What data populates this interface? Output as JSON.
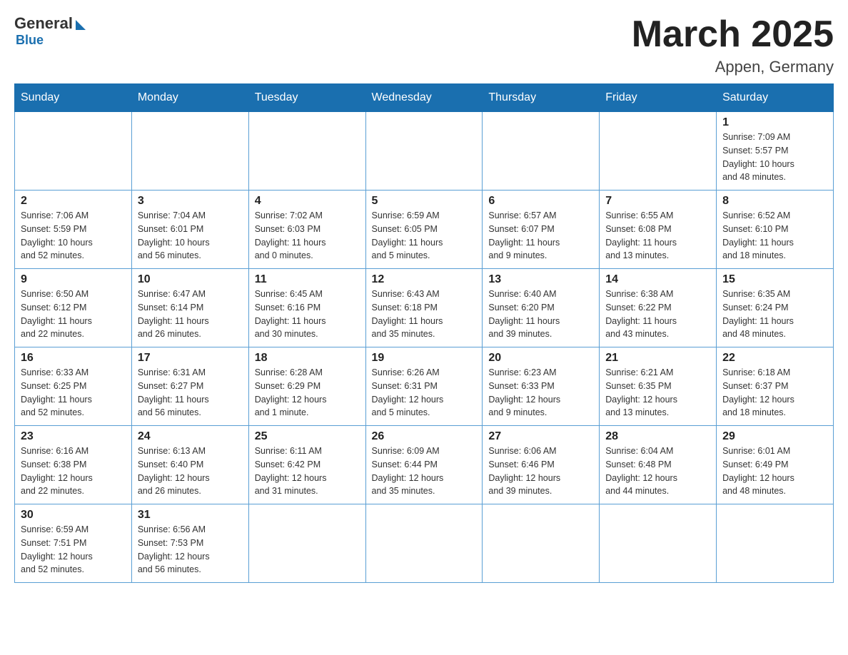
{
  "header": {
    "logo_general": "General",
    "logo_blue": "Blue",
    "month_title": "March 2025",
    "location": "Appen, Germany"
  },
  "weekdays": [
    "Sunday",
    "Monday",
    "Tuesday",
    "Wednesday",
    "Thursday",
    "Friday",
    "Saturday"
  ],
  "weeks": [
    [
      {
        "day": "",
        "info": ""
      },
      {
        "day": "",
        "info": ""
      },
      {
        "day": "",
        "info": ""
      },
      {
        "day": "",
        "info": ""
      },
      {
        "day": "",
        "info": ""
      },
      {
        "day": "",
        "info": ""
      },
      {
        "day": "1",
        "info": "Sunrise: 7:09 AM\nSunset: 5:57 PM\nDaylight: 10 hours\nand 48 minutes."
      }
    ],
    [
      {
        "day": "2",
        "info": "Sunrise: 7:06 AM\nSunset: 5:59 PM\nDaylight: 10 hours\nand 52 minutes."
      },
      {
        "day": "3",
        "info": "Sunrise: 7:04 AM\nSunset: 6:01 PM\nDaylight: 10 hours\nand 56 minutes."
      },
      {
        "day": "4",
        "info": "Sunrise: 7:02 AM\nSunset: 6:03 PM\nDaylight: 11 hours\nand 0 minutes."
      },
      {
        "day": "5",
        "info": "Sunrise: 6:59 AM\nSunset: 6:05 PM\nDaylight: 11 hours\nand 5 minutes."
      },
      {
        "day": "6",
        "info": "Sunrise: 6:57 AM\nSunset: 6:07 PM\nDaylight: 11 hours\nand 9 minutes."
      },
      {
        "day": "7",
        "info": "Sunrise: 6:55 AM\nSunset: 6:08 PM\nDaylight: 11 hours\nand 13 minutes."
      },
      {
        "day": "8",
        "info": "Sunrise: 6:52 AM\nSunset: 6:10 PM\nDaylight: 11 hours\nand 18 minutes."
      }
    ],
    [
      {
        "day": "9",
        "info": "Sunrise: 6:50 AM\nSunset: 6:12 PM\nDaylight: 11 hours\nand 22 minutes."
      },
      {
        "day": "10",
        "info": "Sunrise: 6:47 AM\nSunset: 6:14 PM\nDaylight: 11 hours\nand 26 minutes."
      },
      {
        "day": "11",
        "info": "Sunrise: 6:45 AM\nSunset: 6:16 PM\nDaylight: 11 hours\nand 30 minutes."
      },
      {
        "day": "12",
        "info": "Sunrise: 6:43 AM\nSunset: 6:18 PM\nDaylight: 11 hours\nand 35 minutes."
      },
      {
        "day": "13",
        "info": "Sunrise: 6:40 AM\nSunset: 6:20 PM\nDaylight: 11 hours\nand 39 minutes."
      },
      {
        "day": "14",
        "info": "Sunrise: 6:38 AM\nSunset: 6:22 PM\nDaylight: 11 hours\nand 43 minutes."
      },
      {
        "day": "15",
        "info": "Sunrise: 6:35 AM\nSunset: 6:24 PM\nDaylight: 11 hours\nand 48 minutes."
      }
    ],
    [
      {
        "day": "16",
        "info": "Sunrise: 6:33 AM\nSunset: 6:25 PM\nDaylight: 11 hours\nand 52 minutes."
      },
      {
        "day": "17",
        "info": "Sunrise: 6:31 AM\nSunset: 6:27 PM\nDaylight: 11 hours\nand 56 minutes."
      },
      {
        "day": "18",
        "info": "Sunrise: 6:28 AM\nSunset: 6:29 PM\nDaylight: 12 hours\nand 1 minute."
      },
      {
        "day": "19",
        "info": "Sunrise: 6:26 AM\nSunset: 6:31 PM\nDaylight: 12 hours\nand 5 minutes."
      },
      {
        "day": "20",
        "info": "Sunrise: 6:23 AM\nSunset: 6:33 PM\nDaylight: 12 hours\nand 9 minutes."
      },
      {
        "day": "21",
        "info": "Sunrise: 6:21 AM\nSunset: 6:35 PM\nDaylight: 12 hours\nand 13 minutes."
      },
      {
        "day": "22",
        "info": "Sunrise: 6:18 AM\nSunset: 6:37 PM\nDaylight: 12 hours\nand 18 minutes."
      }
    ],
    [
      {
        "day": "23",
        "info": "Sunrise: 6:16 AM\nSunset: 6:38 PM\nDaylight: 12 hours\nand 22 minutes."
      },
      {
        "day": "24",
        "info": "Sunrise: 6:13 AM\nSunset: 6:40 PM\nDaylight: 12 hours\nand 26 minutes."
      },
      {
        "day": "25",
        "info": "Sunrise: 6:11 AM\nSunset: 6:42 PM\nDaylight: 12 hours\nand 31 minutes."
      },
      {
        "day": "26",
        "info": "Sunrise: 6:09 AM\nSunset: 6:44 PM\nDaylight: 12 hours\nand 35 minutes."
      },
      {
        "day": "27",
        "info": "Sunrise: 6:06 AM\nSunset: 6:46 PM\nDaylight: 12 hours\nand 39 minutes."
      },
      {
        "day": "28",
        "info": "Sunrise: 6:04 AM\nSunset: 6:48 PM\nDaylight: 12 hours\nand 44 minutes."
      },
      {
        "day": "29",
        "info": "Sunrise: 6:01 AM\nSunset: 6:49 PM\nDaylight: 12 hours\nand 48 minutes."
      }
    ],
    [
      {
        "day": "30",
        "info": "Sunrise: 6:59 AM\nSunset: 7:51 PM\nDaylight: 12 hours\nand 52 minutes."
      },
      {
        "day": "31",
        "info": "Sunrise: 6:56 AM\nSunset: 7:53 PM\nDaylight: 12 hours\nand 56 minutes."
      },
      {
        "day": "",
        "info": ""
      },
      {
        "day": "",
        "info": ""
      },
      {
        "day": "",
        "info": ""
      },
      {
        "day": "",
        "info": ""
      },
      {
        "day": "",
        "info": ""
      }
    ]
  ]
}
